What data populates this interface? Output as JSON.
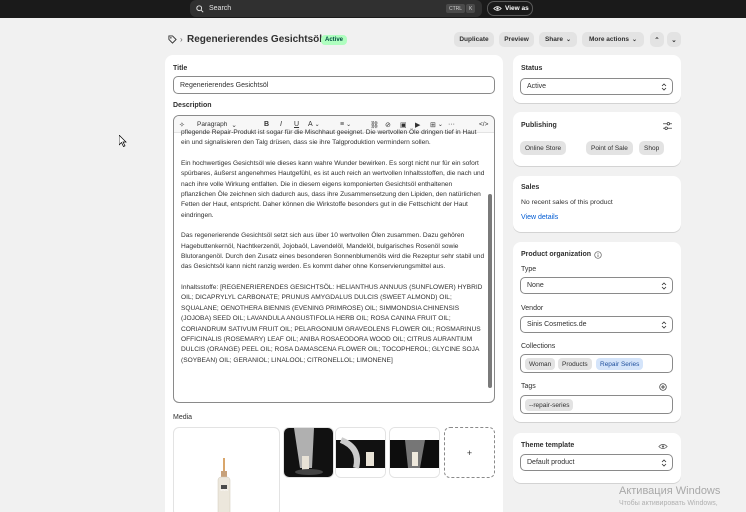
{
  "topbar": {
    "search_placeholder": "Search",
    "kbd1": "CTRL",
    "kbd2": "K",
    "view_as": "View as"
  },
  "header": {
    "title": "Regenerierendes Gesichtsöl",
    "status_badge": "Active",
    "duplicate": "Duplicate",
    "preview": "Preview",
    "share": "Share",
    "more_actions": "More actions"
  },
  "main": {
    "title_label": "Title",
    "title_value": "Regenerierendes Gesichtsöl",
    "description_label": "Description",
    "toolbar": {
      "paragraph": "Paragraph",
      "bold": "B",
      "italic": "I",
      "underline": "U",
      "color": "A",
      "more": "···",
      "code": "</>"
    },
    "description_paragraphs": [
      "pflegende Repair-Produkt ist sogar für die Mischhaut geeignet. Die wertvollen Öle dringen tief in Haut ein und signalisieren den Talg drüsen, dass sie ihre Talgproduktion vermindern sollen.",
      "Ein hochwertiges Gesichtsöl wie dieses kann wahre Wunder bewirken. Es sorgt nicht nur für ein sofort spürbares, äußerst angenehmes Hautgefühl, es ist auch reich an wertvollen Inhaltsstoffen, die nach und nach ihre volle Wirkung entfalten. Die in diesem eigens komponierten Gesichtsöl enthaltenen pflanzlichen Öle zeichnen sich dadurch aus, dass ihre Zusammensetzung den Lipiden, den natürlichen Fetten der Haut, entspricht. Daher können die Wirkstoffe besonders gut in die Fettschicht der Haut eindringen.",
      "Das regenerierende Gesichtsöl setzt sich aus über 10 wertvollen Ölen zusammen. Dazu gehören Hagebuttenkernöl, Nachtkerzenöl, Jojobaöl, Lavendelöl, Mandelöl, bulgarisches Rosenöl sowie Blutorangenöl. Durch den Zusatz eines besonderen Sonnenblumenöls wird die Rezeptur sehr stabil und das Gesichtsöl kann nicht ranzig werden. Es kommt daher ohne Konservierungsmittel aus.",
      "Inhaltsstoffe: [REGENERIERENDES GESICHTSÖL: HELIANTHUS ANNUUS (SUNFLOWER) HYBRID OIL; DICAPRYLYL CARBONATE; PRUNUS AMYGDALUS DULCIS (SWEET ALMOND) OIL; SQUALANE; OENOTHERA BIENNIS (EVENING PRIMROSE) OIL; SIMMONDSIA CHINENSIS (JOJOBA) SEED OIL; LAVANDULA ANGUSTIFOLIA HERB OIL; ROSA CANINA FRUIT OIL; CORIANDRUM SATIVUM FRUIT OIL; PELARGONIUM GRAVEOLENS FLOWER OIL; ROSMARINUS OFFICINALIS (ROSEMARY) LEAF OIL; ANIBA ROSAEODORA WOOD OIL; CITRUS AURANTIUM DULCIS (ORANGE) PEEL OIL; ROSA DAMASCENA FLOWER OIL; TOCOPHEROL; GLYCINE SOJA (SOYBEAN) OIL; GERANIOL; LINALOOL; CITRONELLOL; LIMONENE]"
    ],
    "media_label": "Media",
    "media_logo_text": "SINIS",
    "add_media": "+"
  },
  "sidebar": {
    "status": {
      "label": "Status",
      "value": "Active"
    },
    "publishing": {
      "label": "Publishing",
      "channels": [
        "Online Store",
        "Point of Sale",
        "Shop"
      ]
    },
    "sales": {
      "label": "Sales",
      "text": "No recent sales of this product",
      "link": "View details"
    },
    "organization": {
      "label": "Product organization",
      "type_label": "Type",
      "type_value": "None",
      "vendor_label": "Vendor",
      "vendor_value": "Sinis Cosmetics.de",
      "collections_label": "Collections",
      "collections": [
        "Woman",
        "Products",
        "Repair Series"
      ],
      "tags_label": "Tags",
      "tags": [
        "--repair-series"
      ]
    },
    "theme": {
      "label": "Theme template",
      "value": "Default product"
    }
  },
  "watermark": {
    "line1": "Активация Windows",
    "line2": "Чтобы активировать Windows,"
  },
  "colors": {
    "accent": "#005bd3",
    "active_badge": "#affebf",
    "topbar": "#1a1a1a"
  }
}
